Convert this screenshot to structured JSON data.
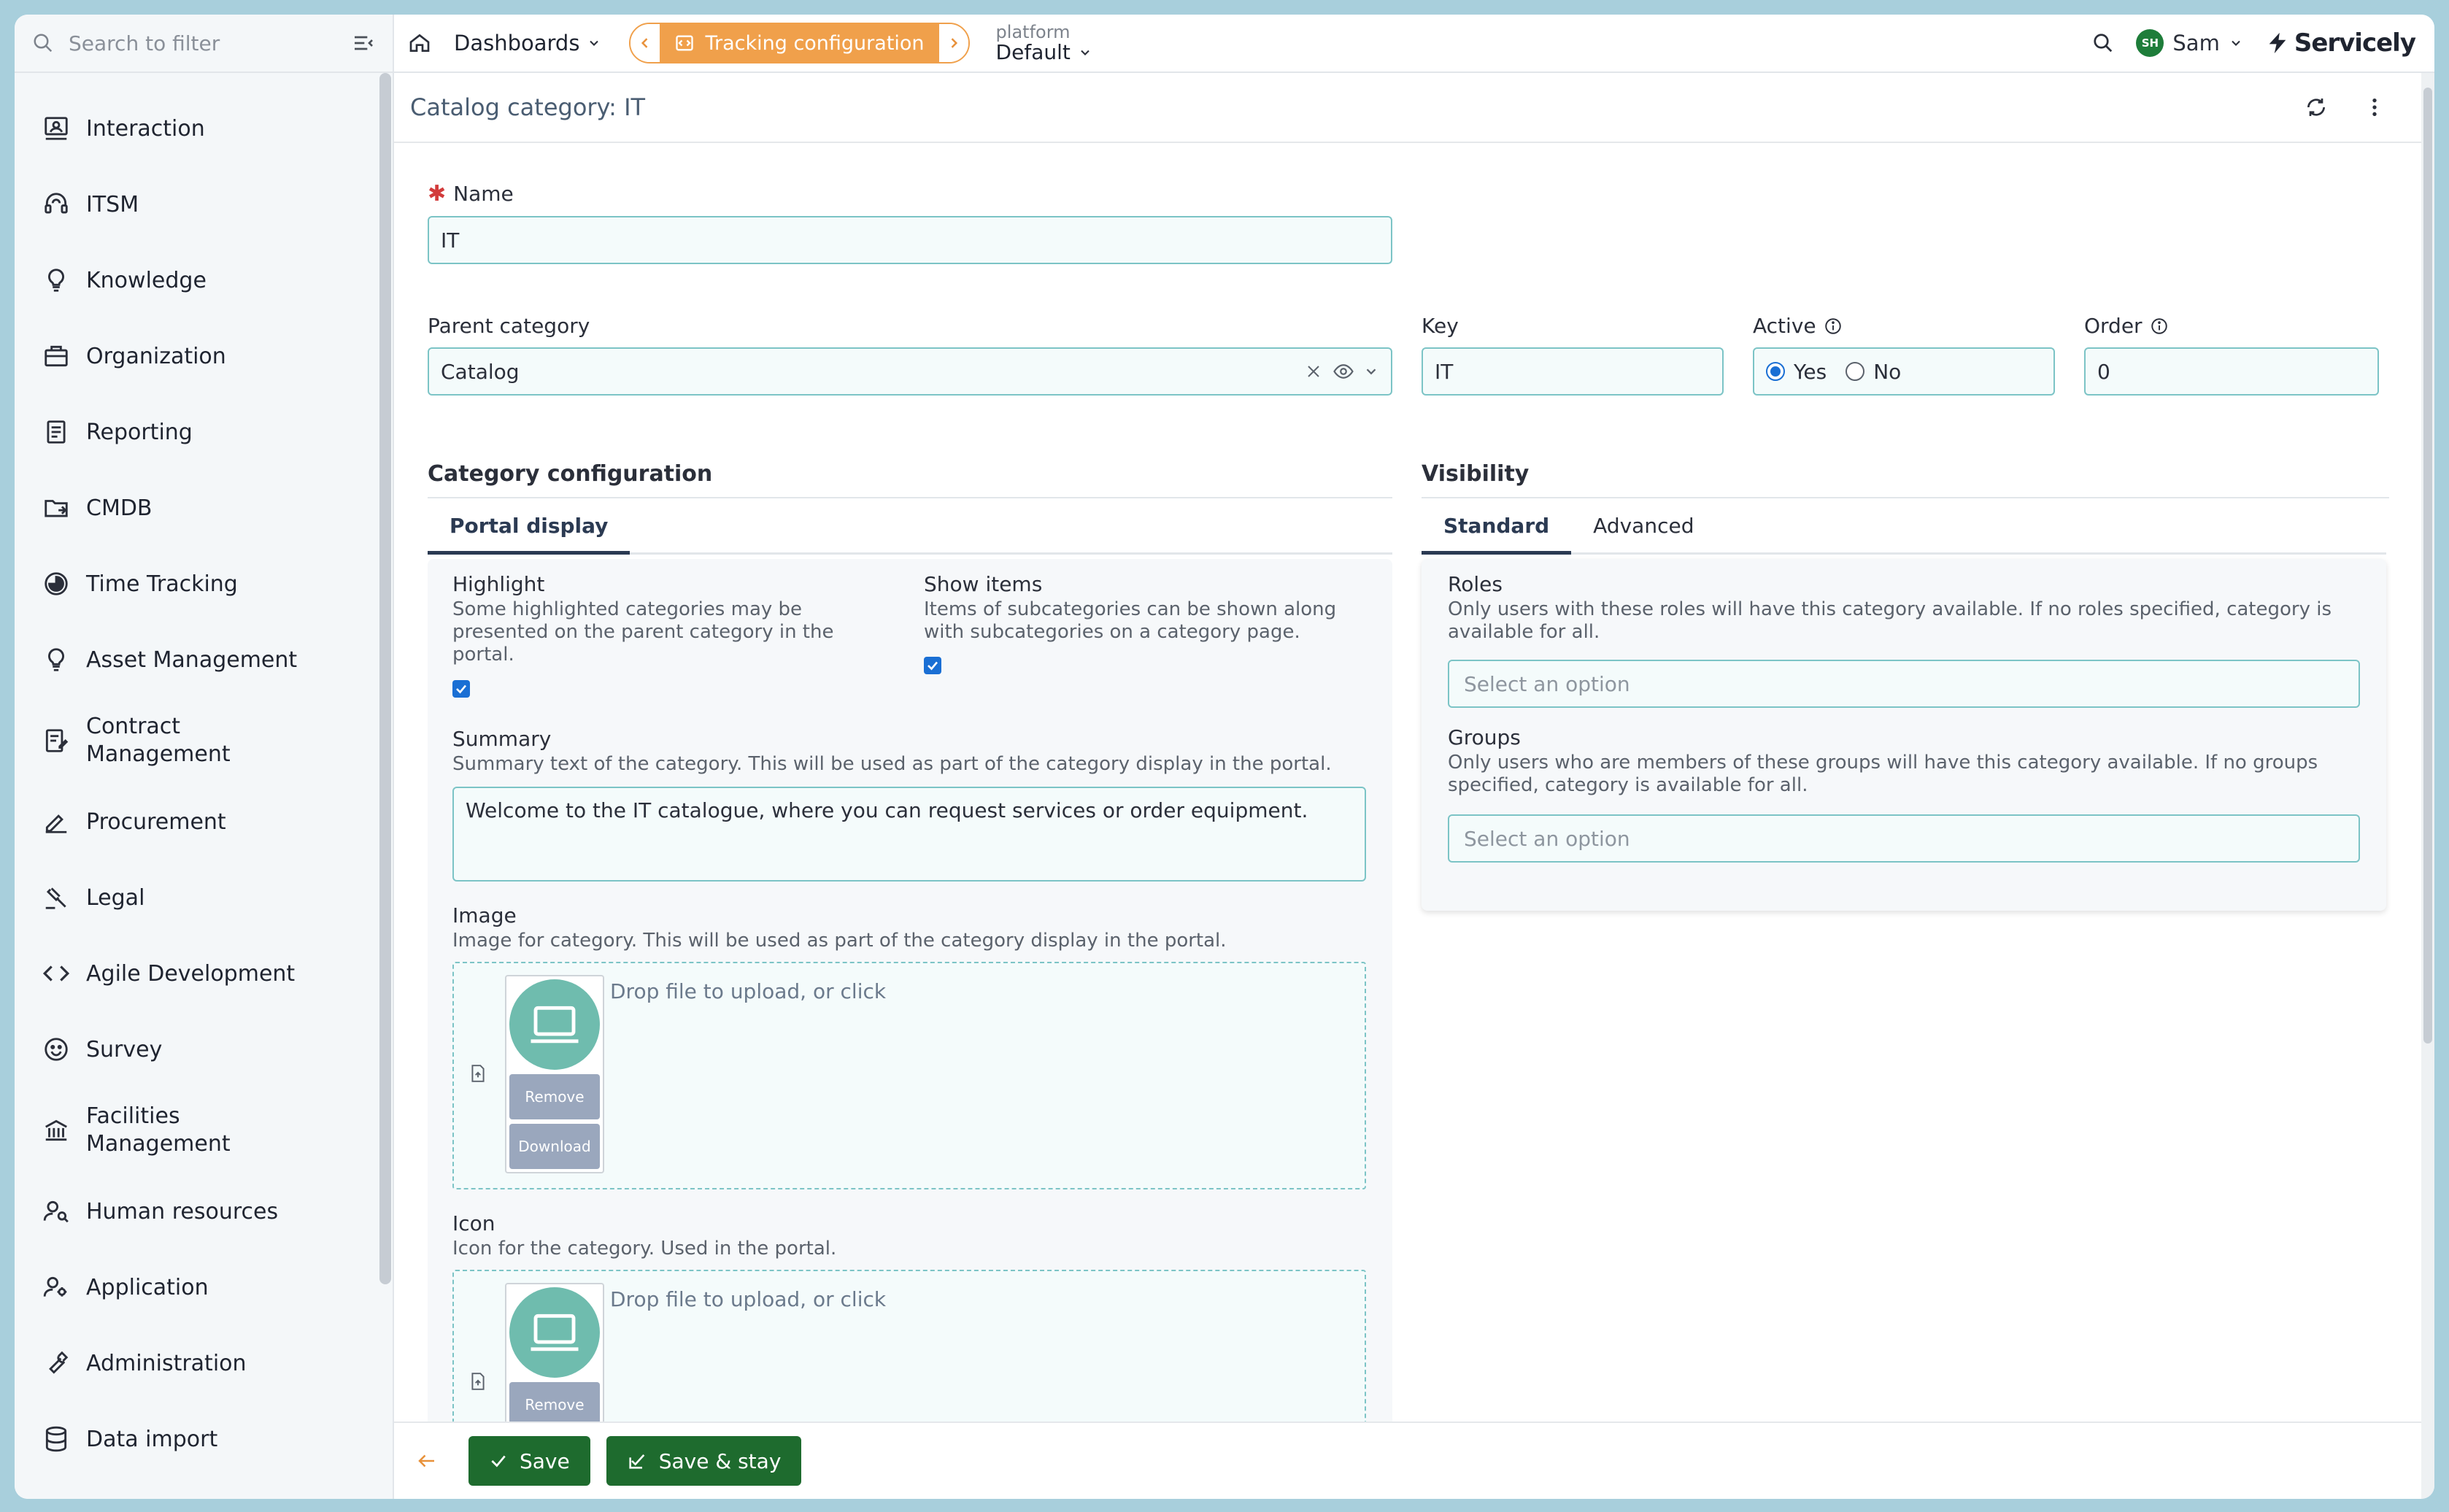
{
  "sidebar": {
    "search_placeholder": "Search to filter",
    "items": [
      {
        "label": "Interaction",
        "icon": "interaction-icon"
      },
      {
        "label": "ITSM",
        "icon": "headset-icon"
      },
      {
        "label": "Knowledge",
        "icon": "lightbulb-icon"
      },
      {
        "label": "Organization",
        "icon": "briefcase-icon"
      },
      {
        "label": "Reporting",
        "icon": "report-icon"
      },
      {
        "label": "CMDB",
        "icon": "folder-icon"
      },
      {
        "label": "Time Tracking",
        "icon": "clock-icon"
      },
      {
        "label": "Asset Management",
        "icon": "lightbulb-icon"
      },
      {
        "label": "Contract Management",
        "icon": "contract-icon"
      },
      {
        "label": "Procurement",
        "icon": "pen-icon"
      },
      {
        "label": "Legal",
        "icon": "gavel-icon"
      },
      {
        "label": "Agile Development",
        "icon": "code-icon"
      },
      {
        "label": "Survey",
        "icon": "smiley-icon"
      },
      {
        "label": "Facilities Management",
        "icon": "building-icon"
      },
      {
        "label": "Human resources",
        "icon": "person-search-icon"
      },
      {
        "label": "Application",
        "icon": "person-gear-icon"
      },
      {
        "label": "Administration",
        "icon": "wrench-icon"
      },
      {
        "label": "Data import",
        "icon": "database-icon"
      }
    ]
  },
  "topbar": {
    "dashboards": "Dashboards",
    "tracking": "Tracking configuration",
    "platform_label": "platform",
    "platform_value": "Default",
    "user": "Sam",
    "user_initials": "SH",
    "brand": "Servicely"
  },
  "page": {
    "title": "Catalog category: IT"
  },
  "form": {
    "name_label": "Name",
    "name_value": "IT",
    "parent_label": "Parent category",
    "parent_value": "Catalog",
    "key_label": "Key",
    "key_value": "IT",
    "active_label": "Active",
    "active_yes": "Yes",
    "active_no": "No",
    "order_label": "Order",
    "order_value": "0",
    "category_config_title": "Category configuration",
    "portal_tab": "Portal display",
    "highlight_label": "Highlight",
    "highlight_help": "Some highlighted categories may be presented on the parent category in the portal.",
    "show_items_label": "Show items",
    "show_items_help": "Items of subcategories can be shown along with subcategories on a category page.",
    "summary_label": "Summary",
    "summary_help": "Summary text of the category. This will be used as part of the category display in the portal.",
    "summary_value": "Welcome to the IT catalogue, where you can request services or order equipment.",
    "image_label": "Image",
    "image_help": "Image for category. This will be used as part of the category display in the portal.",
    "drop_text": "Drop file to upload, or click",
    "remove_label": "Remove",
    "download_label": "Download",
    "icon_label": "Icon",
    "icon_help": "Icon for the category. Used in the portal.",
    "visibility_title": "Visibility",
    "tab_standard": "Standard",
    "tab_advanced": "Advanced",
    "roles_label": "Roles",
    "roles_help": "Only users with these roles will have this category available. If no roles specified, category is available for all.",
    "roles_placeholder": "Select an option",
    "groups_label": "Groups",
    "groups_help": "Only users who are members of these groups will have this category available. If no groups specified, category is available for all.",
    "groups_placeholder": "Select an option"
  },
  "footer": {
    "save": "Save",
    "save_stay": "Save & stay"
  },
  "colors": {
    "accent_orange": "#f0a04b",
    "save_green": "#1e6b2e",
    "input_border": "#7cc4c6",
    "checkbox_blue": "#1a6fd4"
  }
}
